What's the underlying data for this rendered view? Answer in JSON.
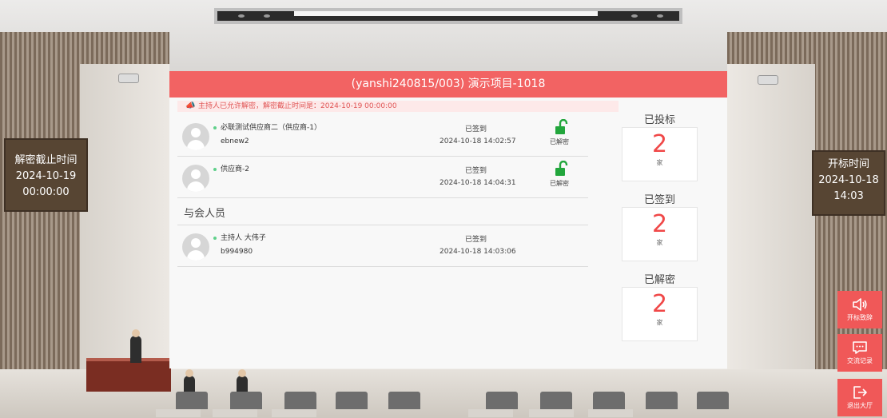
{
  "header": {
    "title": "(yanshi240815/003) 演示项目-1018"
  },
  "notice": {
    "text": "主持人已允许解密，解密截止时间是：2024-10-19 00:00:00"
  },
  "bidders": [
    {
      "name": "必联测试供应商二（供应商-1）",
      "account": "ebnew2",
      "status": "已签到",
      "time": "2024-10-18 14:02:57",
      "decrypt": "已解密"
    },
    {
      "name": "供应商-2",
      "account": "",
      "status": "已签到",
      "time": "2024-10-18 14:04:31",
      "decrypt": "已解密"
    }
  ],
  "attendees_title": "与会人员",
  "attendees": [
    {
      "name": "主持人 大伟子",
      "account": "b994980",
      "status": "已签到",
      "time": "2024-10-18 14:03:06"
    }
  ],
  "stats": [
    {
      "title": "已投标",
      "value": "2",
      "unit": "家"
    },
    {
      "title": "已签到",
      "value": "2",
      "unit": "家"
    },
    {
      "title": "已解密",
      "value": "2",
      "unit": "家"
    }
  ],
  "left_board": {
    "label": "解密截止时间",
    "date": "2024-10-19",
    "time": "00:00:00"
  },
  "right_board": {
    "label": "开标时间",
    "date": "2024-10-18",
    "time": "14:03"
  },
  "actions": [
    {
      "label": "开标致辞",
      "icon": "speaker-icon"
    },
    {
      "label": "交流记录",
      "icon": "chat-icon"
    },
    {
      "label": "退出大厅",
      "icon": "exit-icon"
    }
  ],
  "colors": {
    "accent": "#f26363",
    "stat_number": "#f04848",
    "unlock": "#22a63c"
  }
}
